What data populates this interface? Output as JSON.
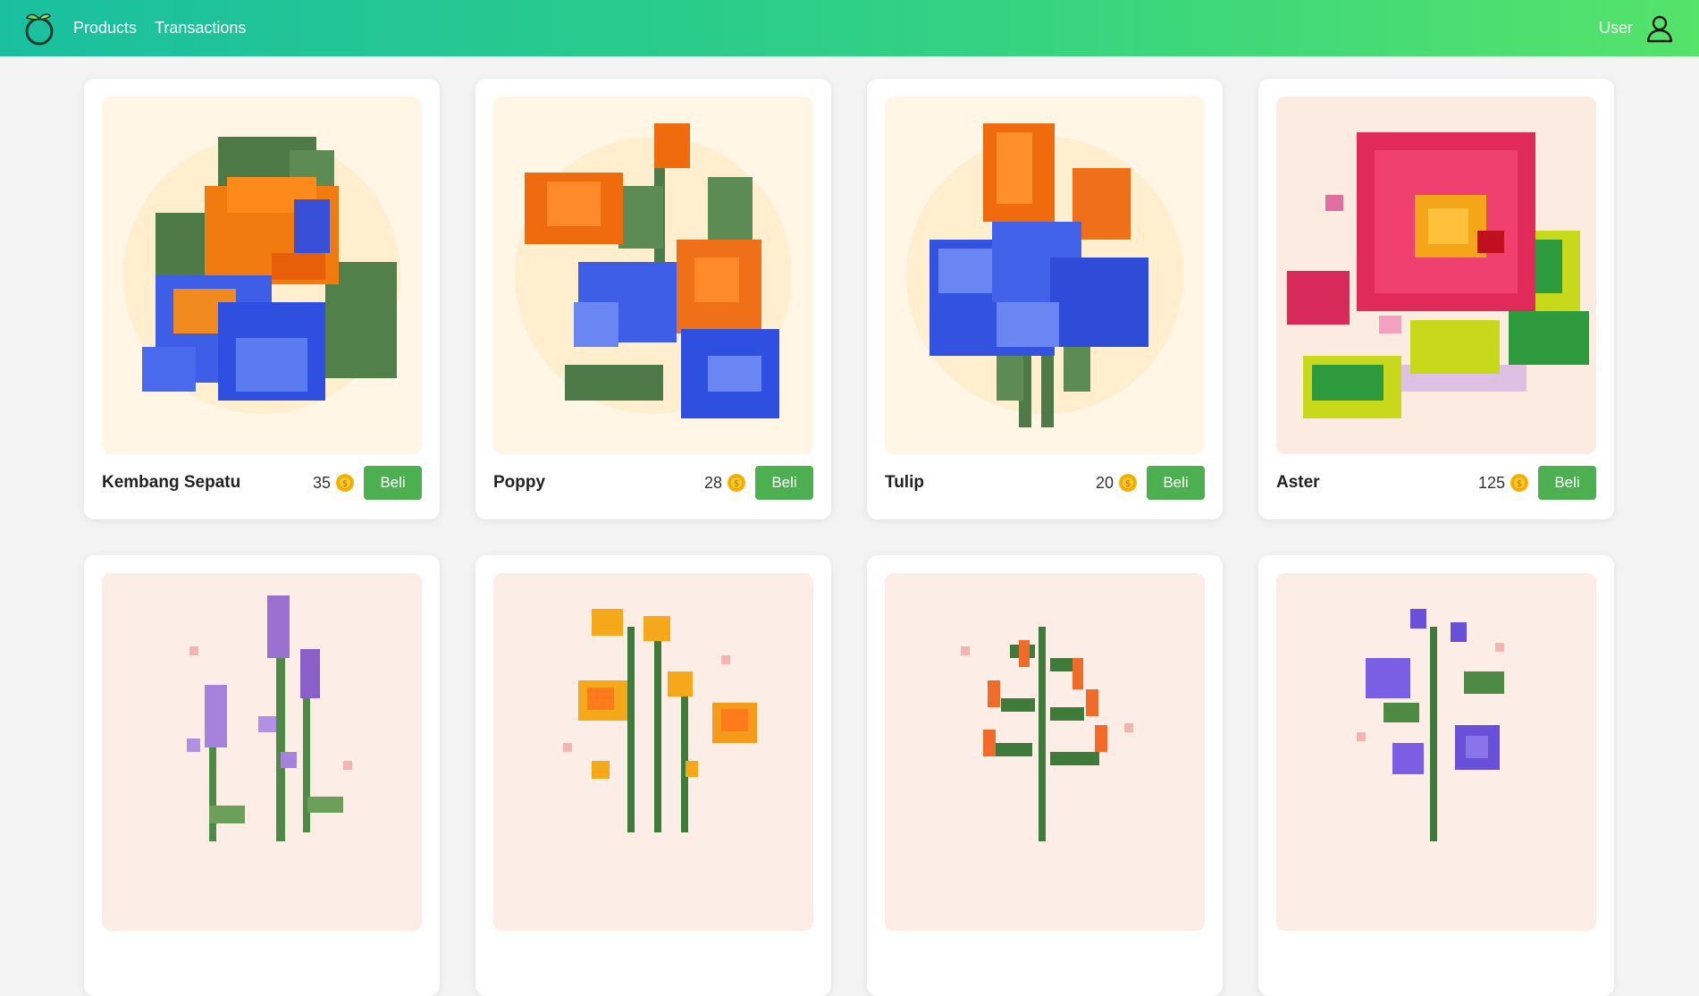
{
  "nav": {
    "links": [
      "Products",
      "Transactions"
    ],
    "user_label": "User"
  },
  "colors": {
    "nav_gradient_start": "#1abfa0",
    "nav_gradient_end": "#55e36a",
    "buy_button": "#4caf50",
    "coin": "#f5b400"
  },
  "products": [
    {
      "name": "Kembang Sepatu",
      "price": "35",
      "button": "Beli",
      "image": "hibiscus-pixel-art",
      "bg": "#fff6e6"
    },
    {
      "name": "Poppy",
      "price": "28",
      "button": "Beli",
      "image": "poppy-pixel-art",
      "bg": "#fff6e6"
    },
    {
      "name": "Tulip",
      "price": "20",
      "button": "Beli",
      "image": "tulip-pixel-art",
      "bg": "#fff6e6"
    },
    {
      "name": "Aster",
      "price": "125",
      "button": "Beli",
      "image": "aster-pixel-art",
      "bg": "#fcebe0"
    },
    {
      "image": "lavender-pixel-art",
      "bg": "#fcede6"
    },
    {
      "image": "yellow-wildflower-pixel-art",
      "bg": "#fcede6"
    },
    {
      "image": "orange-fern-pixel-art",
      "bg": "#fcede6"
    },
    {
      "image": "purple-bellflower-pixel-art",
      "bg": "#fcede6"
    }
  ]
}
